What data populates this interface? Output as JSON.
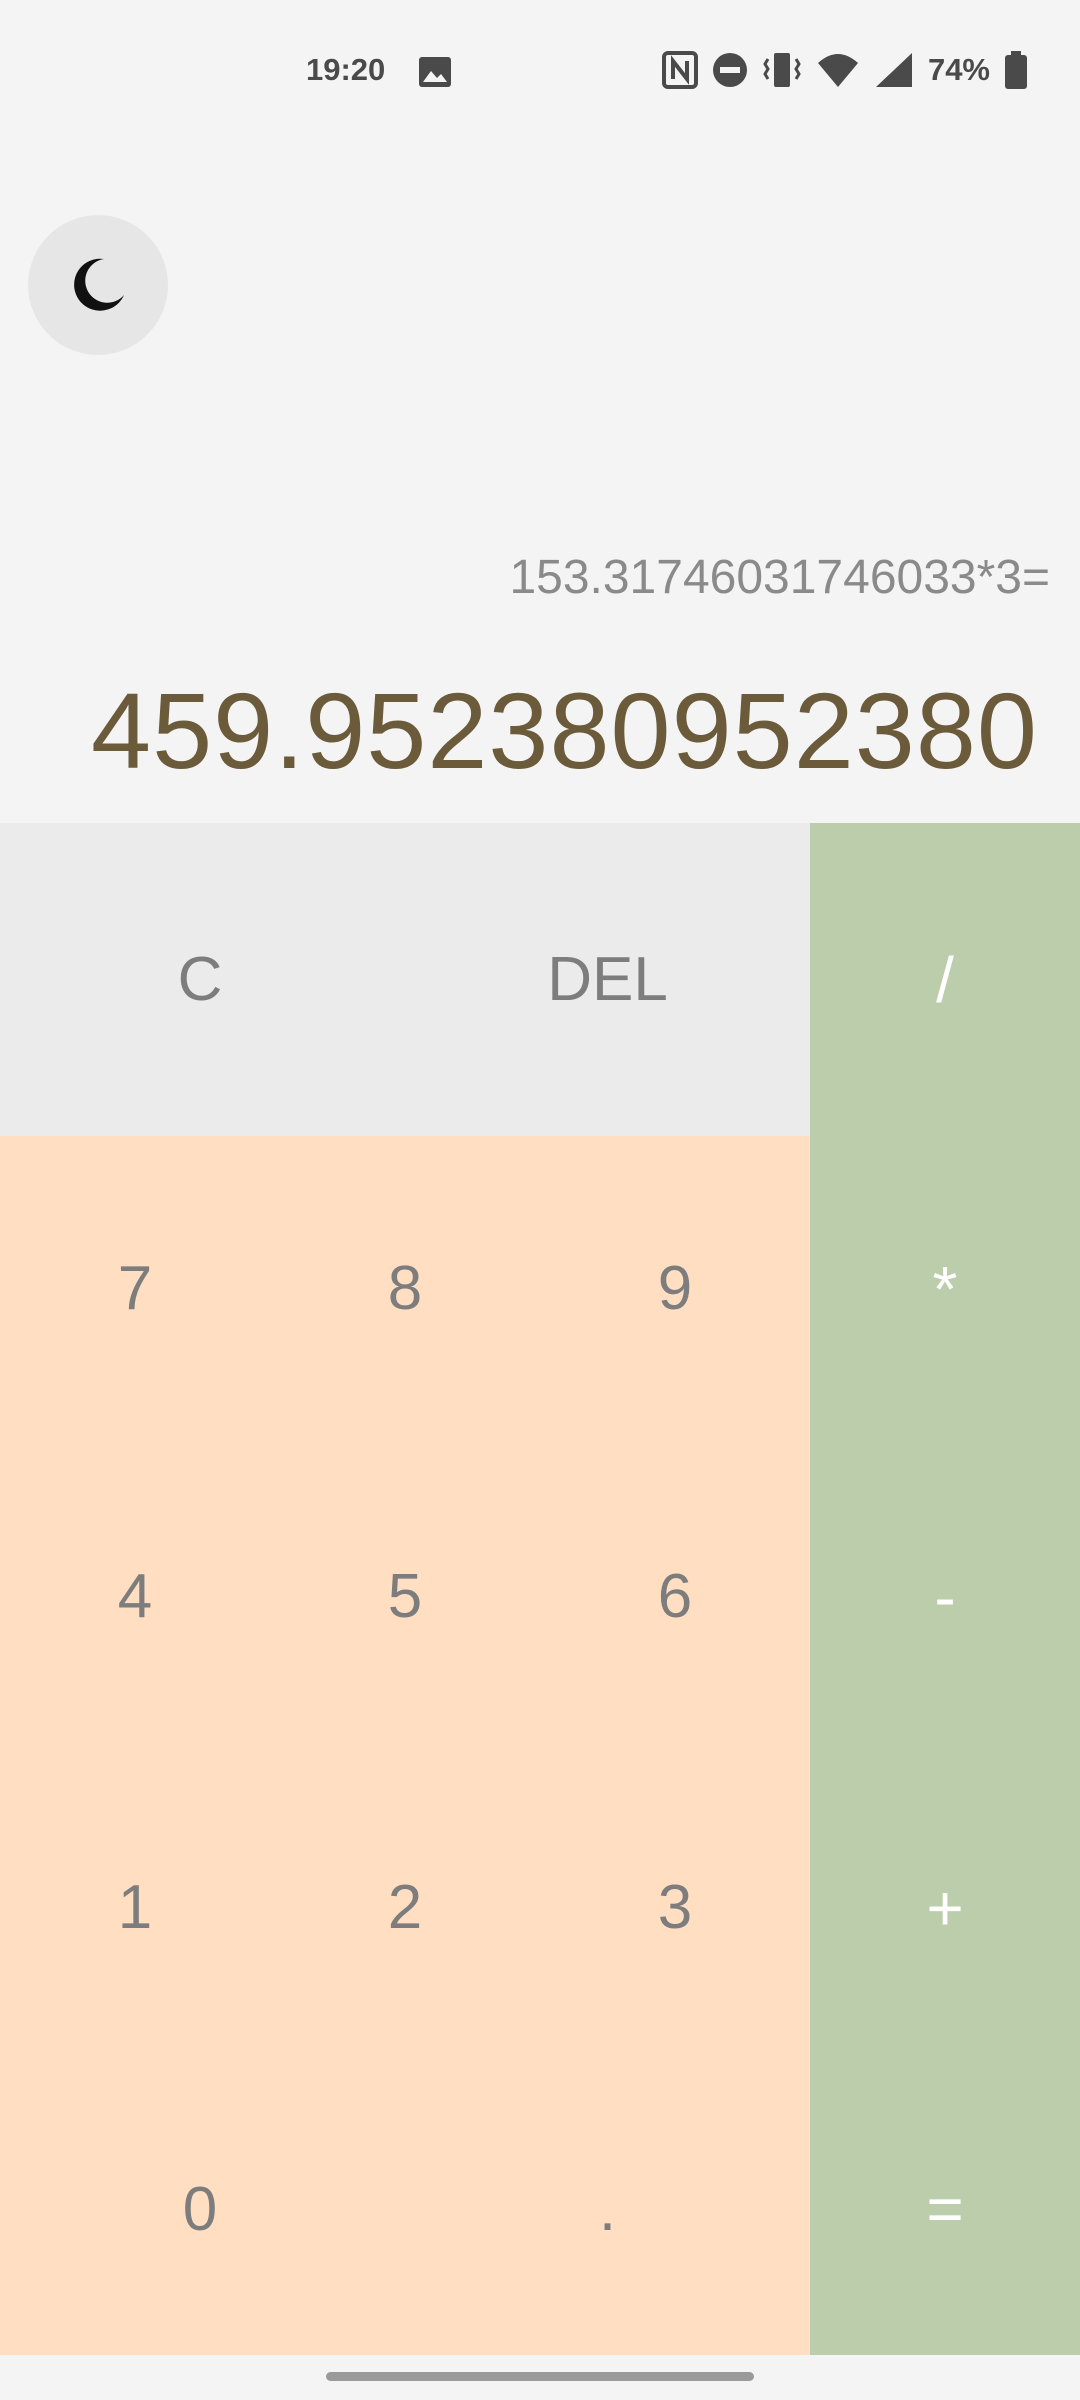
{
  "status_bar": {
    "time": "19:20",
    "battery": "74%",
    "icons": [
      "image-icon",
      "nfc-icon",
      "dnd-icon",
      "vibrate-icon",
      "wifi-icon",
      "signal-icon",
      "battery-icon"
    ]
  },
  "theme_toggle": {
    "icon": "moon-icon"
  },
  "display": {
    "expression": "153.31746031746033*3=",
    "result": "459.952380952380"
  },
  "keys": {
    "clear": "C",
    "delete": "DEL",
    "divide": "/",
    "multiply": "*",
    "minus": "-",
    "plus": "+",
    "equals": "=",
    "seven": "7",
    "eight": "8",
    "nine": "9",
    "four": "4",
    "five": "5",
    "six": "6",
    "one": "1",
    "two": "2",
    "three": "3",
    "zero": "0",
    "dot": "."
  },
  "colors": {
    "background": "#f4f4f4",
    "top_row": "#ebebeb",
    "number_pad": "#ffdec2",
    "operator_column": "#bbcdab",
    "result_text": "#6b5b3a"
  }
}
